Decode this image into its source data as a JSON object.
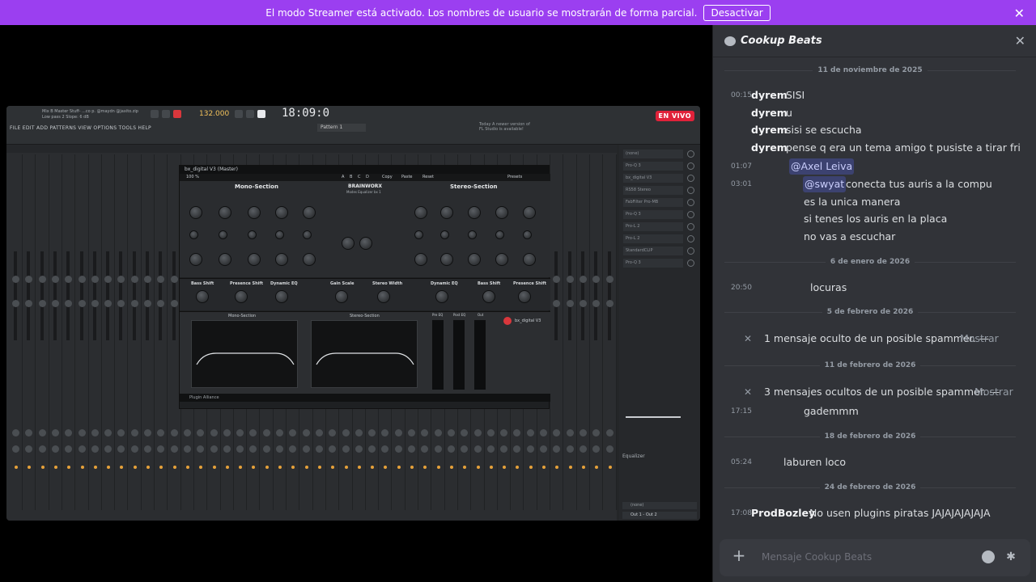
{
  "banner": {
    "text": "El modo Streamer está activado. Los nombres de usuario se mostrarán de forma parcial.",
    "button": "Desactivar"
  },
  "stream": {
    "live_badge": "EN VIVO",
    "daw": {
      "menu": "FILE EDIT ADD PATTERNS VIEW OPTIONS TOOLS HELP",
      "header_lines": [
        "Mix B Master Stuff-  ...co p. @maydn @jaxito.zip",
        "Low pass 2 Slope: 6 dB"
      ],
      "tempo": "132.000",
      "clock": "18:09:0",
      "pattern": "Pattern 1",
      "notice": [
        "Today  A newer version of",
        "FL Studio is available!"
      ],
      "plugin_window_title": "bx_digital V3 (Master)",
      "plugin_zoom": "100 %",
      "plugin_menu": [
        "A",
        "B",
        "C",
        "D",
        "Copy",
        "Paste",
        "Reset"
      ],
      "presets": "Presets",
      "mono_section": "Mono-Section",
      "stereo_section": "Stereo-Section",
      "brand": "BRAINWORX",
      "mode": "Modes Equalizer bx 1",
      "mid_labels": [
        "Bass Shift",
        "Presence Shift",
        "Dynamic EQ",
        "Gain Scale",
        "Stereo Width",
        "Dynamic EQ",
        "Bass Shift",
        "Presence Shift"
      ],
      "vis_labels": [
        "Mono-Section",
        "Stereo-Section",
        "Pre EQ",
        "Post EQ",
        "Out"
      ],
      "product": "bx_digital V3",
      "footer": "Plugin Alliance",
      "mixer_slots": [
        "(none)",
        "Pro-Q 3",
        "bx_digital V3",
        "RS58 Stereo",
        "FabFilter Pro-MB",
        "Pro-Q 3",
        "Pro-L 2",
        "Pro-L 2",
        "StandardCLIP",
        "Pro-Q 3"
      ],
      "equalizer": "Equalizer",
      "out_select": "Out 1 - Out 2",
      "none2": "(none)"
    }
  },
  "chat": {
    "title": "Cookup Beats",
    "dividers": [
      "11 de noviembre de 2025",
      "6 de enero de 2026",
      "5 de febrero de 2026",
      "11 de febrero de 2026",
      "18 de febrero de 2026",
      "24 de febrero de 2026"
    ],
    "messages": [
      {
        "time": "00:15",
        "user": "dyrem",
        "text": "SISI"
      },
      {
        "time": "",
        "user": "dyrem",
        "text": "u"
      },
      {
        "time": "",
        "user": "dyrem",
        "text": "sisi se escucha"
      },
      {
        "time": "",
        "user": "dyrem",
        "text": "pense q era un tema amigo t pusiste a tirar fri"
      },
      {
        "time": "01:07",
        "mention": "@Axel Leiva",
        "text": ""
      },
      {
        "time": "03:01",
        "mention": "@swyat",
        "text": "conecta tus auris a la compu"
      },
      {
        "time": "",
        "text": "es la unica manera"
      },
      {
        "time": "",
        "text": "si tenes los auris en la placa"
      },
      {
        "time": "",
        "text": "no vas a escuchar"
      },
      {
        "time": "20:50",
        "text": "locuras"
      },
      {
        "time": "17:15",
        "text": "gademmm"
      },
      {
        "time": "05:24",
        "text": "laburen loco"
      },
      {
        "time": "17:08",
        "user": "ProdBozley",
        "text": "No usen plugins piratas JAJAJAJAJAJA"
      }
    ],
    "spam": [
      {
        "text": "1 mensaje oculto de un posible spammer. —",
        "link": "Mostrar"
      },
      {
        "text": "3 mensajes ocultos de un posible spammer. —",
        "link": "Mostrar"
      }
    ],
    "composer_placeholder": "Mensaje  Cookup Beats "
  }
}
